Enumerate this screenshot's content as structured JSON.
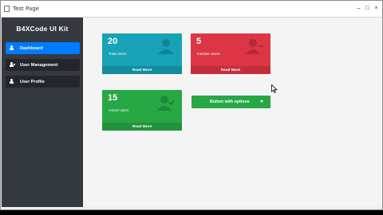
{
  "window": {
    "title": "Test Page",
    "controls": [
      "minimize-icon",
      "maximize-icon",
      "close-icon"
    ]
  },
  "sidebar": {
    "brand": "B4XCode UI Kit",
    "items": [
      {
        "label": "Dashboard",
        "icon": "user-icon",
        "active": true
      },
      {
        "label": "User Management",
        "icon": "users-icon",
        "active": false
      },
      {
        "label": "User Profile",
        "icon": "user-icon",
        "active": false
      }
    ]
  },
  "cards": {
    "total": {
      "count": "20",
      "label": "Total Users",
      "footer": "Read More",
      "color": "#17a2b8"
    },
    "inactive": {
      "count": "5",
      "label": "Inactive Users",
      "footer": "Read More",
      "color": "#dc3545"
    },
    "active": {
      "count": "15",
      "label": "Active Users",
      "footer": "Read More",
      "color": "#28a745"
    }
  },
  "dropdown": {
    "label": "Button with options",
    "color": "#28a745"
  },
  "colors": {
    "sidebar": "#343a40",
    "accent": "#007bff"
  }
}
